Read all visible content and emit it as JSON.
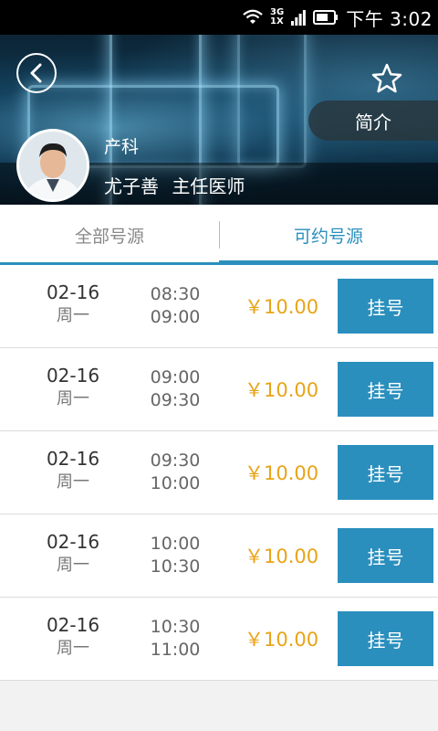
{
  "status_bar": {
    "network_top": "3G",
    "network_bottom": "1X",
    "time": "下午 3:02"
  },
  "header": {
    "intro_label": "简介",
    "department": "产科",
    "doctor_name": "尤子善",
    "doctor_title": "主任医师"
  },
  "tabs": [
    {
      "label": "全部号源",
      "selected": false
    },
    {
      "label": "可约号源",
      "selected": true
    }
  ],
  "slots": [
    {
      "date": "02-16",
      "weekday": "周一",
      "start": "08:30",
      "end": "09:00",
      "price": "￥10.00",
      "button": "挂号"
    },
    {
      "date": "02-16",
      "weekday": "周一",
      "start": "09:00",
      "end": "09:30",
      "price": "￥10.00",
      "button": "挂号"
    },
    {
      "date": "02-16",
      "weekday": "周一",
      "start": "09:30",
      "end": "10:00",
      "price": "￥10.00",
      "button": "挂号"
    },
    {
      "date": "02-16",
      "weekday": "周一",
      "start": "10:00",
      "end": "10:30",
      "price": "￥10.00",
      "button": "挂号"
    },
    {
      "date": "02-16",
      "weekday": "周一",
      "start": "10:30",
      "end": "11:00",
      "price": "￥10.00",
      "button": "挂号"
    }
  ],
  "colors": {
    "accent": "#2a8fbd",
    "price": "#e8a417"
  },
  "icons": [
    "wifi-icon",
    "signal-icon",
    "battery-icon",
    "back-icon",
    "star-icon"
  ]
}
